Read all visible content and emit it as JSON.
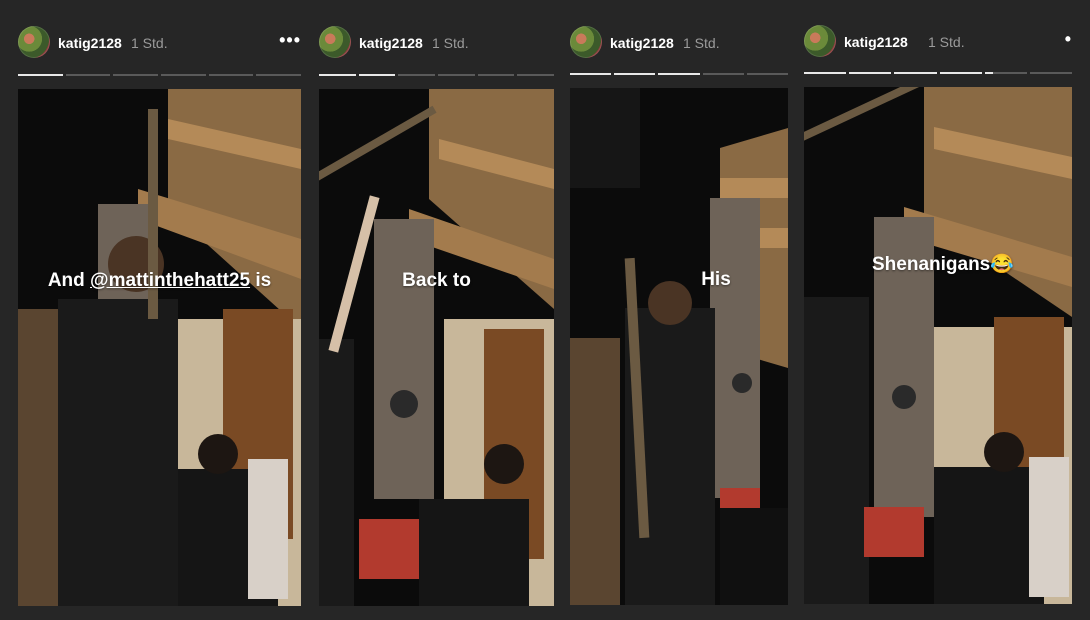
{
  "stories": [
    {
      "username": "katig2128",
      "time": "1 Std.",
      "more_icon": "more-dots-icon",
      "more_label": "•••",
      "progress": [
        1,
        0,
        0,
        0,
        0,
        0
      ],
      "caption_prefix": "And ",
      "caption_mention": "@mattinthehatt25",
      "caption_suffix": " is"
    },
    {
      "username": "katig2128",
      "time": "1 Std.",
      "progress": [
        1,
        1,
        0,
        0,
        0,
        0
      ],
      "caption": "Back to"
    },
    {
      "username": "katig2128",
      "time": "1 Std.",
      "progress": [
        1,
        1,
        1,
        0,
        0
      ],
      "caption": "His"
    },
    {
      "username": "katig2128",
      "time": "1 Std.",
      "more_icon": "dot-icon",
      "more_label": "•",
      "progress": [
        1,
        1,
        1,
        1,
        0.2,
        0
      ],
      "caption": "Shenanigans😂"
    }
  ]
}
